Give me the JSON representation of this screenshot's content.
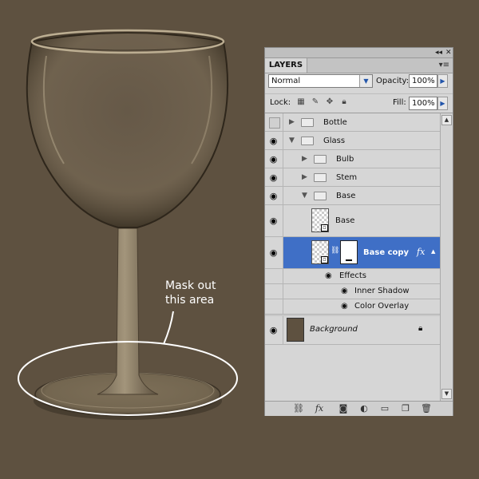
{
  "annotation": {
    "line1": "Mask out",
    "line2": "this area"
  },
  "panel": {
    "title": "LAYERS",
    "blend_mode": "Normal",
    "opacity_label": "Opacity:",
    "opacity_value": "100%",
    "lock_label": "Lock:",
    "fill_label": "Fill:",
    "fill_value": "100%",
    "layers": [
      {
        "name": "Bottle",
        "kind": "group",
        "level": 0,
        "expanded": false,
        "visible": false
      },
      {
        "name": "Glass",
        "kind": "group",
        "level": 0,
        "expanded": true,
        "visible": true
      },
      {
        "name": "Bulb",
        "kind": "group",
        "level": 1,
        "expanded": false,
        "visible": true
      },
      {
        "name": "Stem",
        "kind": "group",
        "level": 1,
        "expanded": false,
        "visible": true
      },
      {
        "name": "Base",
        "kind": "group",
        "level": 1,
        "expanded": true,
        "visible": true
      },
      {
        "name": "Base",
        "kind": "layer",
        "level": 2,
        "visible": true
      },
      {
        "name": "Base copy",
        "kind": "layer",
        "level": 2,
        "visible": true,
        "selected": true,
        "has_mask": true,
        "has_fx": true
      },
      {
        "name": "Effects",
        "kind": "effects-header"
      },
      {
        "name": "Inner Shadow",
        "kind": "effect"
      },
      {
        "name": "Color Overlay",
        "kind": "effect"
      },
      {
        "name": "Background",
        "kind": "background",
        "visible": true,
        "locked": true
      }
    ],
    "bottom_icons": [
      "link-icon",
      "fx-icon",
      "mask-icon",
      "adjustment-icon",
      "folder-icon",
      "new-layer-icon",
      "trash-icon"
    ]
  },
  "colors": {
    "background": "#5e5140",
    "selection": "#3f6fc6",
    "ellipse": "#ffffff"
  }
}
